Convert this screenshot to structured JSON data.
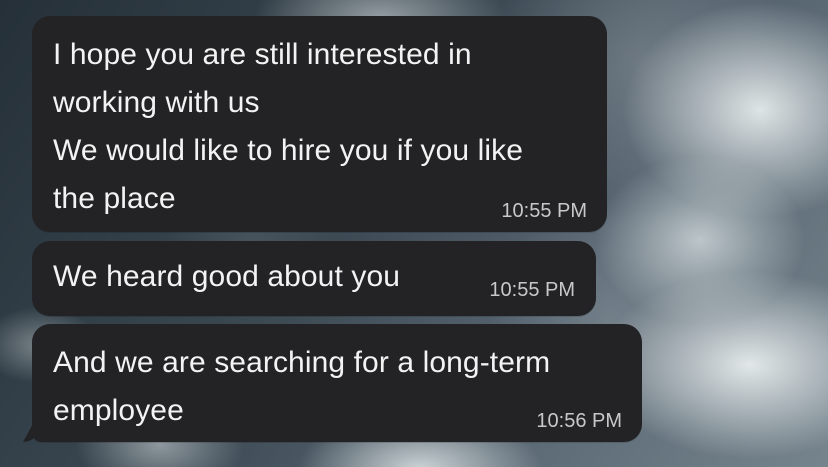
{
  "messages": [
    {
      "text": "I hope you are still interested in\nworking with us\nWe would like to hire you if you like\nthe place",
      "time": "10:55 PM"
    },
    {
      "text": "We heard good about you",
      "time": "10:55 PM"
    },
    {
      "text": "And we are searching for a long-term\nemployee",
      "time": "10:56 PM"
    }
  ],
  "colors": {
    "bubble_background": "#232325",
    "message_text": "#f3f3f3",
    "timestamp_text": "#c8c8c8"
  }
}
